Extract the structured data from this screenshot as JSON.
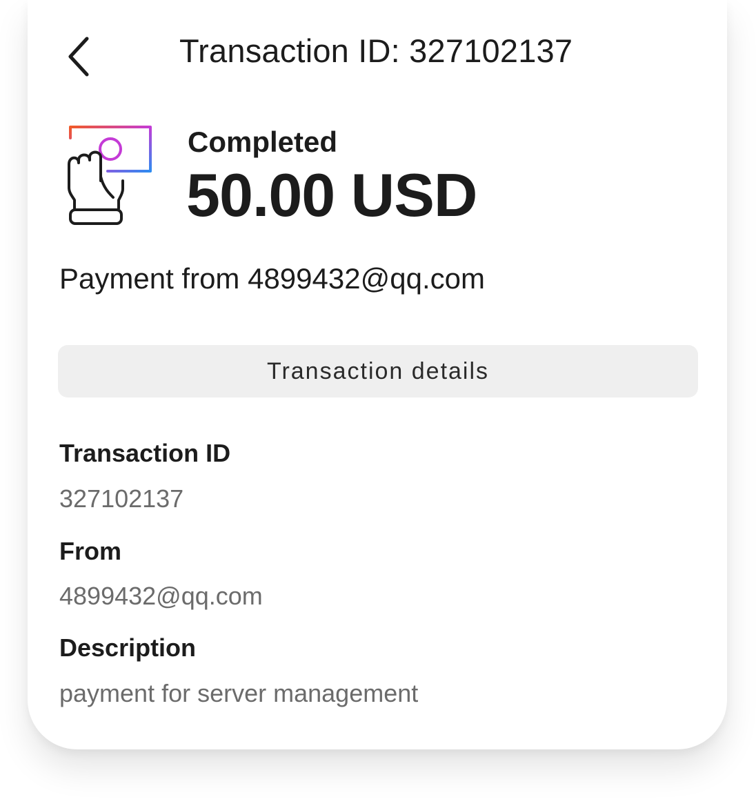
{
  "header": {
    "title": "Transaction ID: 327102137",
    "back_icon": "chevron-left-icon"
  },
  "summary": {
    "icon": "hand-card-payment-icon",
    "status": "Completed",
    "amount": "50.00 USD"
  },
  "payment_from": "Payment from 4899432@qq.com",
  "details_button": {
    "label": "Transaction details"
  },
  "fields": {
    "transaction_id": {
      "label": "Transaction ID",
      "value": "327102137"
    },
    "from": {
      "label": "From",
      "value": "4899432@qq.com"
    },
    "description": {
      "label": "Description",
      "value": "payment for server management"
    }
  },
  "colors": {
    "text": "#1c1c1c",
    "muted_text": "#6b6b6b",
    "button_bg": "#efefef",
    "icon_gradient_start": "#f05a28",
    "icon_gradient_mid": "#c43bd6",
    "icon_gradient_end": "#2e8bf0"
  }
}
